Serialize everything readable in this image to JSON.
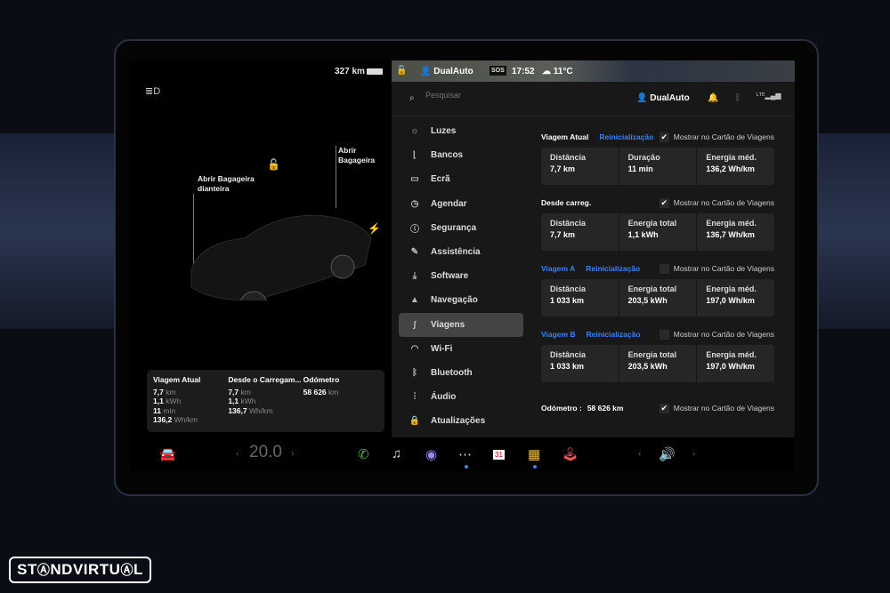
{
  "status": {
    "range": "327 km",
    "user": "DualAuto",
    "sos": "SOS",
    "time": "17:52",
    "temp": "11°C"
  },
  "search": {
    "placeholder": "Pesquisar"
  },
  "profile": {
    "name": "DualAuto"
  },
  "car_view": {
    "frunk_label": "Abrir Bagageira dianteira",
    "trunk_label": "Abrir Bagageira"
  },
  "menu": [
    {
      "icon": "sun-icon",
      "glyph": "☼",
      "label": "Luzes"
    },
    {
      "icon": "seat-icon",
      "glyph": "⌊",
      "label": "Bancos"
    },
    {
      "icon": "display-icon",
      "glyph": "▭",
      "label": "Ecrã"
    },
    {
      "icon": "alarm-icon",
      "glyph": "◷",
      "label": "Agendar"
    },
    {
      "icon": "safety-icon",
      "glyph": "ⓘ",
      "label": "Segurança"
    },
    {
      "icon": "wrench-icon",
      "glyph": "✎",
      "label": "Assistência"
    },
    {
      "icon": "download-icon",
      "glyph": "⤓",
      "label": "Software"
    },
    {
      "icon": "navigation-icon",
      "glyph": "▲",
      "label": "Navegação"
    },
    {
      "icon": "trips-icon",
      "glyph": "∫",
      "label": "Viagens",
      "active": true
    },
    {
      "icon": "wifi-icon",
      "glyph": "◠",
      "label": "Wi-Fi"
    },
    {
      "icon": "bluetooth-icon",
      "glyph": "ᛒ",
      "label": "Bluetooth"
    },
    {
      "icon": "audio-icon",
      "glyph": "⫶",
      "label": "Áudio"
    },
    {
      "icon": "lock-icon",
      "glyph": "🔒",
      "label": "Atualizações"
    }
  ],
  "trips": {
    "show_label": "Mostrar no Cartão de Viagens",
    "sections": [
      {
        "title": "Viagem Atual",
        "reset": "Reinicialização",
        "title_blue": false,
        "checked": true,
        "cards": [
          {
            "label": "Distância",
            "value": "7,7  km"
          },
          {
            "label": "Duração",
            "value": "11  min"
          },
          {
            "label": "Energia méd.",
            "value": "136,2  Wh/km"
          }
        ]
      },
      {
        "title": "Desde carreg.",
        "reset": "",
        "title_blue": false,
        "checked": true,
        "cards": [
          {
            "label": "Distância",
            "value": "7,7  km"
          },
          {
            "label": "Energia total",
            "value": "1,1  kWh"
          },
          {
            "label": "Energia méd.",
            "value": "136,7  Wh/km"
          }
        ]
      },
      {
        "title": "Viagem A",
        "reset": "Reinicialização",
        "title_blue": true,
        "checked": false,
        "cards": [
          {
            "label": "Distância",
            "value": "1 033  km"
          },
          {
            "label": "Energia total",
            "value": "203,5  kWh"
          },
          {
            "label": "Energia méd.",
            "value": "197,0  Wh/km"
          }
        ]
      },
      {
        "title": "Viagem B",
        "reset": "Reinicialização",
        "title_blue": true,
        "checked": false,
        "cards": [
          {
            "label": "Distância",
            "value": "1 033  km"
          },
          {
            "label": "Energia total",
            "value": "203,5  kWh"
          },
          {
            "label": "Energia méd.",
            "value": "197,0  Wh/km"
          }
        ]
      }
    ],
    "odometer_label": "Odómetro  :",
    "odometer_value": "58 626  km",
    "odometer_checked": true
  },
  "trip_card": {
    "cols": [
      {
        "title": "Viagem Atual",
        "rows": [
          [
            "7,7",
            "km"
          ],
          [
            "1,1",
            "kWh"
          ],
          [
            "11",
            "min"
          ],
          [
            "136,2",
            "Wh/km"
          ]
        ]
      },
      {
        "title": "Desde o Carregam...",
        "rows": [
          [
            "7,7",
            "km"
          ],
          [
            "1,1",
            "kWh"
          ],
          [
            "136,7",
            "Wh/km"
          ]
        ]
      },
      {
        "title": "Odómetro",
        "rows": [
          [
            "58 626",
            "km"
          ]
        ]
      }
    ]
  },
  "bottom": {
    "temp": "20.0",
    "accent": "#3a82f7"
  },
  "watermark": "STANDVIRTUAL"
}
